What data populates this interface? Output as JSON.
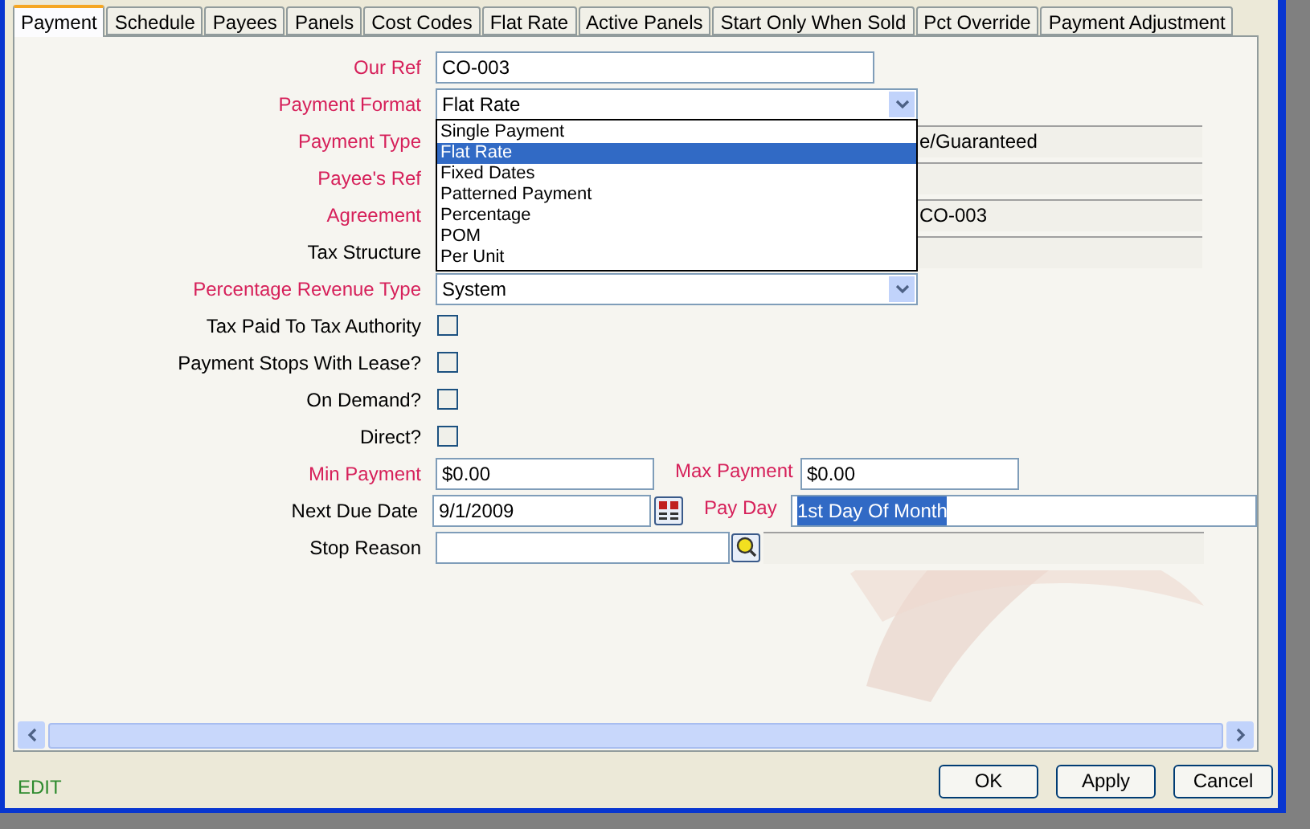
{
  "tabs": [
    {
      "label": "Payment",
      "selected": true
    },
    {
      "label": "Schedule",
      "selected": false
    },
    {
      "label": "Payees",
      "selected": false
    },
    {
      "label": "Panels",
      "selected": false
    },
    {
      "label": "Cost Codes",
      "selected": false
    },
    {
      "label": "Flat Rate",
      "selected": false
    },
    {
      "label": "Active Panels",
      "selected": false
    },
    {
      "label": "Start Only When Sold",
      "selected": false
    },
    {
      "label": "Pct Override",
      "selected": false
    },
    {
      "label": "Payment Adjustment",
      "selected": false
    }
  ],
  "form": [
    {
      "kind": "text",
      "label": "Our Ref",
      "required": true,
      "value": "CO-003"
    },
    {
      "kind": "combo",
      "label": "Payment Format",
      "required": true,
      "value": "Flat Rate",
      "expanded": true,
      "options": [
        {
          "label": "Single Payment",
          "selected": false
        },
        {
          "label": "Flat Rate",
          "selected": true
        },
        {
          "label": "Fixed Dates",
          "selected": false
        },
        {
          "label": "Patterned Payment",
          "selected": false
        },
        {
          "label": "Percentage",
          "selected": false
        },
        {
          "label": "POM",
          "selected": false
        },
        {
          "label": "Per Unit",
          "selected": false
        }
      ]
    },
    {
      "kind": "readonly",
      "label": "Payment Type",
      "required": true,
      "value": "e/Guaranteed"
    },
    {
      "kind": "readonly",
      "label": "Payee's Ref",
      "required": true
    },
    {
      "kind": "readonly",
      "label": "Agreement",
      "required": true,
      "value": "CO-003"
    },
    {
      "kind": "readonly",
      "label": "Tax Structure",
      "required": false
    },
    {
      "kind": "combo",
      "label": "Percentage Revenue Type",
      "required": true,
      "value": "System",
      "expanded": false
    },
    {
      "kind": "check",
      "label": "Tax Paid To Tax Authority",
      "required": false,
      "checked": false
    },
    {
      "kind": "check",
      "label": "Payment Stops With Lease?",
      "required": false,
      "checked": false
    },
    {
      "kind": "check",
      "label": "On Demand?",
      "required": false,
      "checked": false
    },
    {
      "kind": "check",
      "label": "Direct?",
      "required": false,
      "checked": false
    },
    {
      "kind": "money_pair",
      "label": "Min Payment",
      "required": true,
      "value": "$0.00",
      "second_label": "Max Payment",
      "second_required": true,
      "second_value": "$0.00"
    },
    {
      "kind": "date_payday",
      "label": "Next Due Date",
      "required": false,
      "value": "9/1/2009",
      "second_label": "Pay Day",
      "second_required": true,
      "second_value": "1st Day Of Month"
    },
    {
      "kind": "lookup",
      "label": "Stop Reason",
      "required": false
    }
  ],
  "status": "EDIT",
  "buttons": [
    "OK",
    "Apply",
    "Cancel"
  ]
}
